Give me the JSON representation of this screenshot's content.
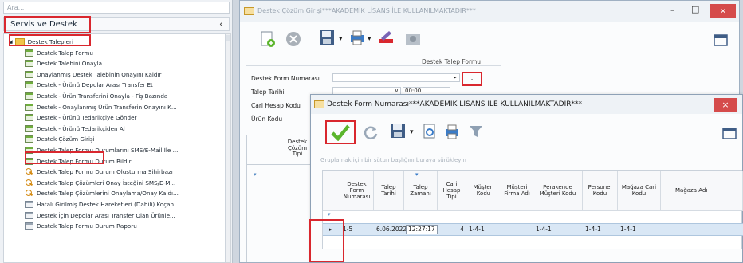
{
  "left_panel": {
    "search_placeholder": "Ara...",
    "title": "Servis ve Destek",
    "collapse_glyph": "‹",
    "tree_root": "Destek Talepleri",
    "items": [
      {
        "label": "Destek Talep Formu",
        "icon": "doc"
      },
      {
        "label": "Destek Talebini Onayla",
        "icon": "doc"
      },
      {
        "label": "Onaylanmış Destek Talebinin Onayını Kaldır",
        "icon": "doc"
      },
      {
        "label": "Destek - Ürünü Depolar Arası Transfer Et",
        "icon": "doc"
      },
      {
        "label": "Destek - Ürün Transferini Onayla - Fiş Bazında",
        "icon": "doc"
      },
      {
        "label": "Destek - Onaylanmış Ürün Transferin Onayını K...",
        "icon": "doc"
      },
      {
        "label": "Destek - Ürünü Tedarikçiye Gönder",
        "icon": "doc"
      },
      {
        "label": "Destek - Ürünü Tedarikçiden Al",
        "icon": "doc"
      },
      {
        "label": "Destek Çözüm Girişi",
        "icon": "doc"
      },
      {
        "label": "Destek Talep Formu Durumlarını SMS/E-Mail İle ...",
        "icon": "doc"
      },
      {
        "label": "Destek Talep Formu Durum Bildir",
        "icon": "doc"
      },
      {
        "label": "Destek Talep Formu Durum Oluşturma Sihirbazı",
        "icon": "query"
      },
      {
        "label": "Destek Talep Çözümleri Onay İsteğini SMS/E-M...",
        "icon": "query"
      },
      {
        "label": "Destek Talep Çözümlerini Onaylama/Onay Kaldı...",
        "icon": "query"
      },
      {
        "label": "Hatalı Girilmiş Destek Hareketleri (Dahili) Koçan ...",
        "icon": "doc2"
      },
      {
        "label": "Destek İçin Depolar Arası Transfer Olan Ürünle...",
        "icon": "doc2"
      },
      {
        "label": "Destek Talep Formu Durum Raporu",
        "icon": "doc2"
      }
    ]
  },
  "back_window": {
    "title": "Destek Çözüm Girişi***AKADEMİK LİSANS İLE KULLANILMAKTADIR***",
    "form_caption": "Destek Talep Formu",
    "fields": [
      {
        "label": "Destek Form Numarası",
        "value": ""
      },
      {
        "label": "Talep Tarihi",
        "value": "00:00"
      },
      {
        "label": "Cari Hesap Kodu",
        "value": ""
      },
      {
        "label": "Ürün Kodu",
        "value": ""
      }
    ],
    "grid_col_label": "Destek Çözüm Tipi",
    "lookup_button": "..."
  },
  "front_window": {
    "title": "Destek Form Numarası***AKADEMİK LİSANS İLE KULLANILMAKTADIR***",
    "group_hint": "Gruplamak için bir sütun başlığını buraya sürükleyin",
    "columns": [
      "Destek Form Numarası",
      "Talep Tarihi",
      "Talep Zamanı",
      "Cari Hesap Tipi",
      "Müşteri Kodu",
      "Müşteri Firma Adı",
      "Perakende Müşteri Kodu",
      "Personel Kodu",
      "Mağaza Cari Kodu",
      "Mağaza Adı"
    ],
    "row": {
      "form_no": "1-5",
      "tarih": "6.06.2022",
      "zaman": "12:27:17",
      "cari_tip": "4",
      "musteri_kodu": "1-4-1",
      "firma_adi": "",
      "perakende": "1-4-1",
      "personel": "1-4-1",
      "magaza_cari": "1-4-1",
      "magaza_adi": ""
    }
  },
  "colors": {
    "highlight_red": "#d9272e",
    "close_red": "#d54b4b",
    "selected_row": "#d9e7f5",
    "check_green": "#5bb52c"
  },
  "window_buttons": {
    "minimize": "–",
    "maximize": "□",
    "close": "×"
  }
}
